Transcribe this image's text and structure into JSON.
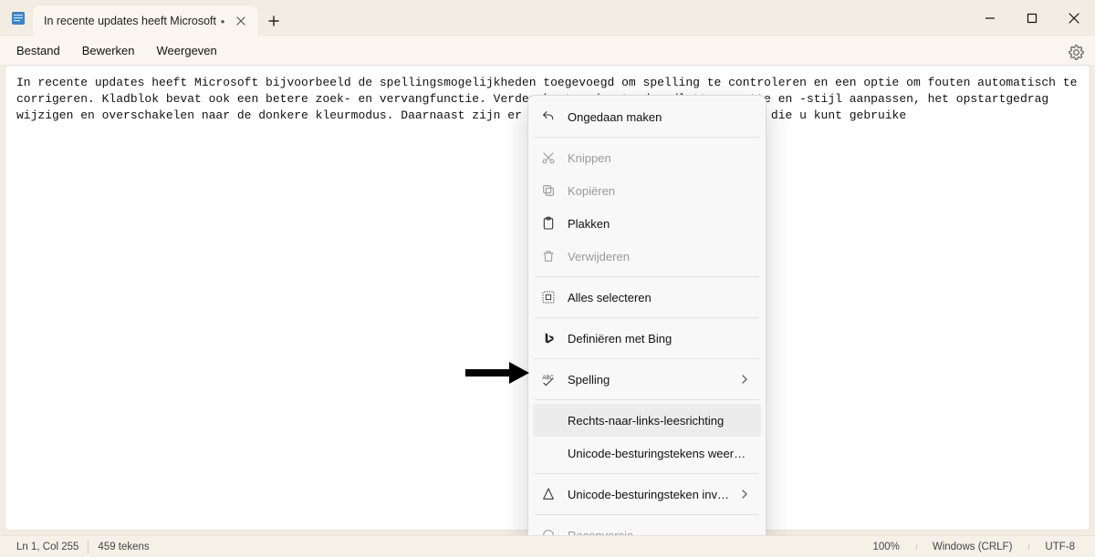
{
  "tab": {
    "title": "In recente updates heeft Microsoft",
    "dirty_mark": "•"
  },
  "menubar": {
    "file": "Bestand",
    "edit": "Bewerken",
    "view": "Weergeven"
  },
  "editor": {
    "text": "In recente updates heeft Microsoft bijvoorbeeld de spellingsmogelijkheden toegevoegd om spelling te controleren en een optie om fouten automatisch te corrigeren. Kladblok bevat ook een betere zoek- en vervangfunctie. Verder kunt u de standaardlettergrootte en -stijl aanpassen, het opstartgedrag wijzigen en overschakelen naar de donkere kleurmodus. Daarnaast zijn er verschillende andere instellingen die u kunt gebruike"
  },
  "statusbar": {
    "position": "Ln 1, Col 255",
    "chars": "459 tekens",
    "zoom": "100%",
    "eol": "Windows (CRLF)",
    "encoding": "UTF-8"
  },
  "context_menu": {
    "undo": "Ongedaan maken",
    "cut": "Knippen",
    "copy": "Kopiëren",
    "paste": "Plakken",
    "delete": "Verwijderen",
    "select_all": "Alles selecteren",
    "define_bing": "Definiëren met Bing",
    "spelling": "Spelling",
    "rtl": "Rechts-naar-links-leesrichting",
    "show_unicode": "Unicode-besturingstekens weergeven",
    "insert_unicode": "Unicode-besturingsteken invoegen",
    "reconvert": "Reconversie"
  }
}
